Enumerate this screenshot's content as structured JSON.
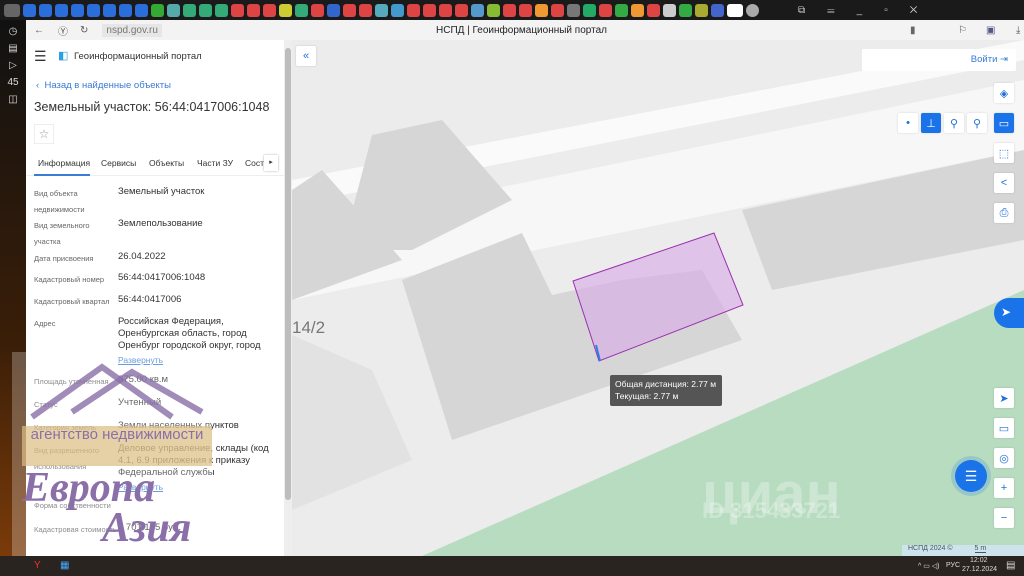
{
  "browser": {
    "url": "nspd.gov.ru",
    "title": "НСПД | Геоинформационный портал",
    "tab_count": "45"
  },
  "panel": {
    "app_title": "Геоинформационный портал",
    "back": "Назад в найденные объекты",
    "title": "Земельный участок: 56:44:0417006:1048",
    "tabs": [
      "Информация",
      "Сервисы",
      "Объекты",
      "Части ЗУ",
      "Состав"
    ],
    "rows": [
      {
        "label": "Вид объекта недвижимости",
        "value": "Земельный участок"
      },
      {
        "label": "Вид земельного участка",
        "value": "Землепользование"
      },
      {
        "label": "Дата присвоения",
        "value": "26.04.2022"
      },
      {
        "label": "Кадастровый номер",
        "value": "56:44:0417006:1048"
      },
      {
        "label": "Кадастровый квартал",
        "value": "56:44:0417006"
      },
      {
        "label": "Адрес",
        "value": "Российская Федерация, Оренбургская область, город Оренбург городской округ, город"
      },
      {
        "label": "Площадь уточненная",
        "value": "375.00 кв.м"
      },
      {
        "label": "Статус",
        "value": "Учтенный"
      },
      {
        "label": "Категория земель",
        "value": "Земли населенных пунктов"
      },
      {
        "label": "Вид разрешенного использования",
        "value": "Деловое управление, склады (код 4.1, 6.9 приложения к приказу Федеральной службы"
      },
      {
        "label": "Форма собственности",
        "value": ""
      },
      {
        "label": "Кадастровая стоимость",
        "value": "1 701 135 руб."
      }
    ],
    "expand": "Развернуть"
  },
  "map": {
    "login": "Войти",
    "label_14_2": "14/2",
    "tooltip_total": "Общая дистанция: 2.77 м",
    "tooltip_current": "Текущая: 2.77 м",
    "copyright": "НСПД 2024 ©",
    "scale": "5 m",
    "parcel_color": "#d9a8e8"
  },
  "watermark": {
    "agency": "агентство недвижимости",
    "brand1": "Европа",
    "brand2": "Азия",
    "cian": "циан",
    "cian_id": "ID 315433721"
  },
  "taskbar": {
    "lang": "РУС",
    "time": "12:02",
    "date": "27.12.2024"
  }
}
